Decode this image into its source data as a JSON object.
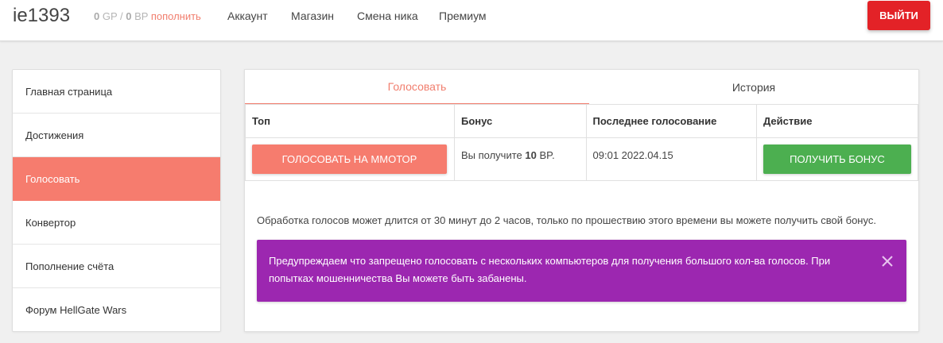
{
  "header": {
    "username": "ie1393",
    "gp_value": "0",
    "gp_unit": " GP / ",
    "bp_value": "0",
    "bp_unit": " BP ",
    "topup_label": "пополнить",
    "nav": [
      "Аккаунт",
      "Магазин",
      "Смена ника",
      "Премиум"
    ],
    "logout_label": "ВЫЙТИ"
  },
  "sidebar": {
    "items": [
      "Главная страница",
      "Достижения",
      "Голосовать",
      "Конвертор",
      "Пополнение счёта",
      "Форум HellGate Wars"
    ],
    "active": "Голосовать"
  },
  "tabs": [
    "Голосовать",
    "История"
  ],
  "table": {
    "headers": [
      "Топ",
      "Бонус",
      "Последнее голосование",
      "Действие"
    ],
    "vote_button": "ГОЛОСОВАТЬ НА ММОТОР",
    "bonus_prefix": "Вы получите ",
    "bonus_amount": "10",
    "bonus_suffix": " BP.",
    "last_vote": "09:01 2022.04.15",
    "get_bonus_button": "ПОЛУЧИТЬ БОНУС"
  },
  "info_text": "Обработка голосов может длится от 30 минут до 2 часов, только по прошествию этого времени вы можете получить свой бонус.",
  "alert": {
    "text": "Предупреждаем что запрещено голосовать с нескольких компьютеров для получения большого кол-ва голосов. При попытках мошенничества Вы можете быть забанены."
  },
  "colors": {
    "accent": "#f67c6e",
    "danger": "#e32227",
    "success": "#4caf50",
    "alert": "#9c27b0"
  }
}
